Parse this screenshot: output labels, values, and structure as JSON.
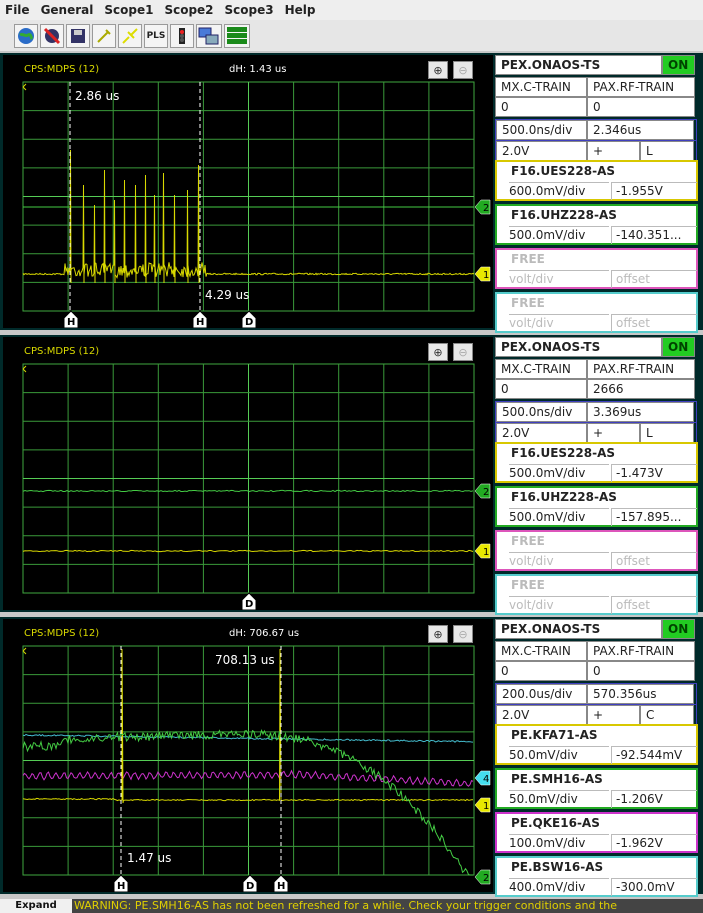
{
  "menu": [
    "File",
    "General",
    "Scope1",
    "Scope2",
    "Scope3",
    "Help"
  ],
  "toolbar": {
    "pls_label": "PLS"
  },
  "scopes": [
    {
      "title": "CPS:MDPS (12)",
      "dh": "dH: 1.43 us",
      "cursor_top": "2.86 us",
      "cursor_bottom": "4.29 us",
      "panel": {
        "name": "PEX.ONAOS-TS",
        "status": "ON",
        "train1": "MX.C-TRAIN",
        "train2": "PAX.RF-TRAIN",
        "v1": "0",
        "v2": "0",
        "timediv": "500.0ns/div",
        "delay": "2.346us",
        "volt": "2.0V",
        "slope": "+",
        "coupling": "L",
        "ch": [
          {
            "name": "F16.UES228-AS",
            "vd": "600.0mV/div",
            "of": "-1.955V"
          },
          {
            "name": "F16.UHZ228-AS",
            "vd": "500.0mV/div",
            "of": "-140.351..."
          },
          {
            "name": "FREE",
            "vd": "volt/div",
            "of": "offset"
          },
          {
            "name": "FREE",
            "vd": "volt/div",
            "of": "offset"
          }
        ]
      }
    },
    {
      "title": "CPS:MDPS (12)",
      "panel": {
        "name": "PEX.ONAOS-TS",
        "status": "ON",
        "train1": "MX.C-TRAIN",
        "train2": "PAX.RF-TRAIN",
        "v1": "0",
        "v2": "2666",
        "timediv": "500.0ns/div",
        "delay": "3.369us",
        "volt": "2.0V",
        "slope": "+",
        "coupling": "L",
        "ch": [
          {
            "name": "F16.UES228-AS",
            "vd": "500.0mV/div",
            "of": "-1.473V"
          },
          {
            "name": "F16.UHZ228-AS",
            "vd": "500.0mV/div",
            "of": "-157.895..."
          },
          {
            "name": "FREE",
            "vd": "volt/div",
            "of": "offset"
          },
          {
            "name": "FREE",
            "vd": "volt/div",
            "of": "offset"
          }
        ]
      }
    },
    {
      "title": "CPS:MDPS (12)",
      "dh": "dH: 706.67 us",
      "cursor_top": "708.13 us",
      "cursor_bottom": "1.47 us",
      "panel": {
        "name": "PEX.ONAOS-TS",
        "status": "ON",
        "train1": "MX.C-TRAIN",
        "train2": "PAX.RF-TRAIN",
        "v1": "0",
        "v2": "0",
        "timediv": "200.0us/div",
        "delay": "570.356us",
        "volt": "2.0V",
        "slope": "+",
        "coupling": "C",
        "ch": [
          {
            "name": "PE.KFA71-AS",
            "vd": "50.0mV/div",
            "of": "-92.544mV"
          },
          {
            "name": "PE.SMH16-AS",
            "vd": "50.0mV/div",
            "of": "-1.206V"
          },
          {
            "name": "PE.QKE16-AS",
            "vd": "100.0mV/div",
            "of": "-1.962V"
          },
          {
            "name": "PE.BSW16-AS",
            "vd": "400.0mV/div",
            "of": "-300.0mV"
          }
        ]
      }
    }
  ],
  "markers": {
    "m1": "1",
    "m2": "2",
    "m4": "4",
    "h": "H",
    "d": "D"
  },
  "status": {
    "expand": "Expand",
    "warning": "WARNING: PE.SMH16-AS has not been refreshed for a while. Check your trigger conditions and the"
  }
}
